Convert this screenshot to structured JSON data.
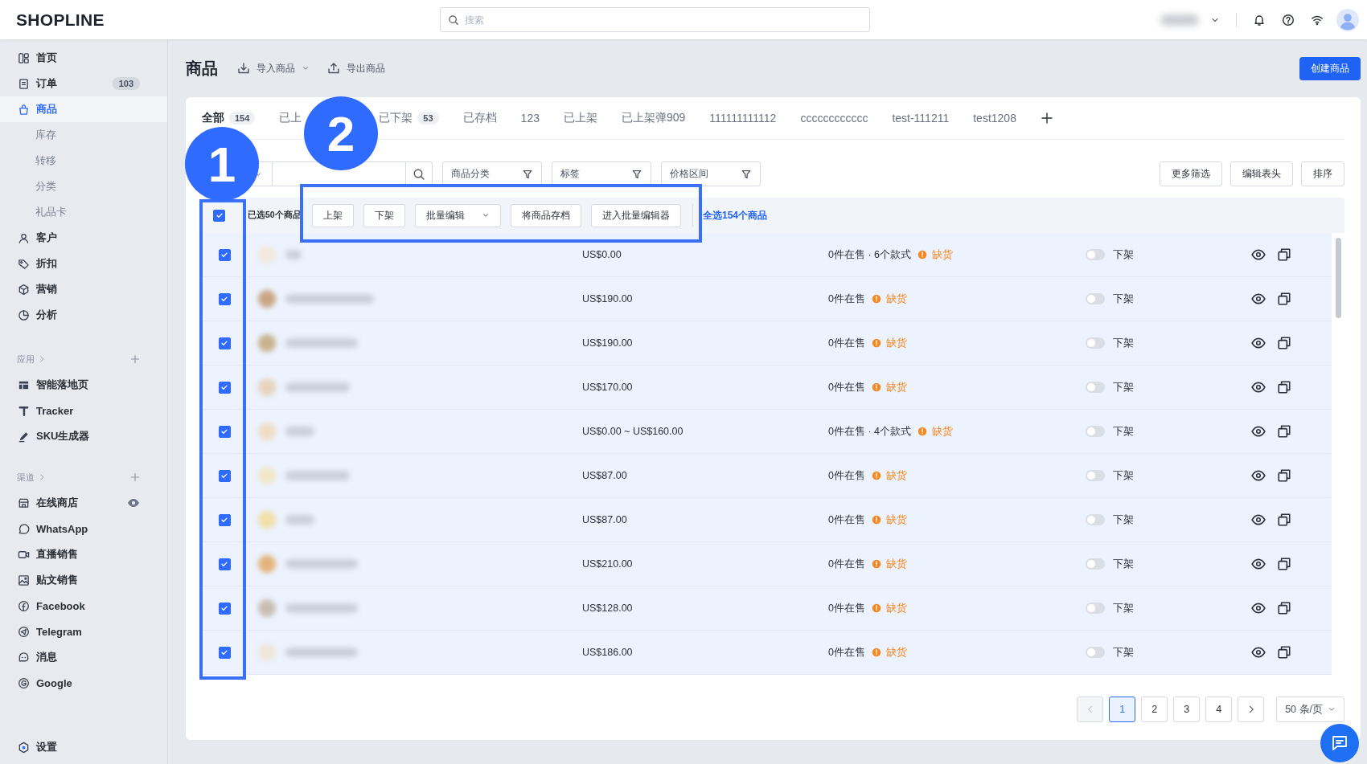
{
  "topbar": {
    "logo": "SHOPLINE",
    "search": {
      "placeholder": "搜索"
    }
  },
  "sidebar": {
    "items": [
      {
        "label": "首页",
        "selected": false
      },
      {
        "label": "订单",
        "badge": "103",
        "selected": false
      },
      {
        "label": "商品",
        "selected": true,
        "children": [
          {
            "label": "库存",
            "selected": false
          },
          {
            "label": "转移",
            "selected": false
          },
          {
            "label": "分类",
            "selected": false
          },
          {
            "label": "礼品卡",
            "selected": false
          }
        ]
      },
      {
        "label": "客户",
        "selected": false
      },
      {
        "label": "折扣",
        "selected": false
      },
      {
        "label": "营销",
        "selected": false
      },
      {
        "label": "分析",
        "selected": false
      }
    ],
    "sections": [
      {
        "title": "应用",
        "items": [
          {
            "label": "智能落地页",
            "selected": false
          },
          {
            "label": "Tracker",
            "selected": false
          },
          {
            "label": "SKU生成器",
            "selected": false
          }
        ]
      },
      {
        "title": "渠道",
        "items": [
          {
            "label": "在线商店",
            "selected": false,
            "preview": true
          },
          {
            "label": "WhatsApp",
            "selected": false
          },
          {
            "label": "直播销售",
            "selected": false
          },
          {
            "label": "贴文销售",
            "selected": false
          },
          {
            "label": "Facebook",
            "selected": false
          },
          {
            "label": "Telegram",
            "selected": false
          },
          {
            "label": "消息",
            "selected": false
          },
          {
            "label": "Google",
            "selected": false
          }
        ]
      }
    ],
    "footer": {
      "label": "设置"
    }
  },
  "header": {
    "title": "商品",
    "actions": [
      {
        "label": "导入商品",
        "dropdown": true
      },
      {
        "label": "导出商品",
        "dropdown": false
      }
    ],
    "primary_button": "创建商品"
  },
  "tabs": [
    {
      "label": "全部",
      "count": "154",
      "selected": true
    },
    {
      "label": "已上",
      "selected": false
    },
    {
      "label": "已下架",
      "count": "53",
      "selected": false
    },
    {
      "label": "已存档",
      "selected": false
    },
    {
      "label": "123",
      "selected": false
    },
    {
      "label": "已上架",
      "selected": false
    },
    {
      "label": "已上架弹909",
      "selected": false
    },
    {
      "label": "111111111112",
      "selected": false
    },
    {
      "label": "cccccccccccc",
      "selected": false
    },
    {
      "label": "test-111211",
      "selected": false
    },
    {
      "label": "test1208",
      "selected": false
    }
  ],
  "filters": [
    {
      "label": "商品分类"
    },
    {
      "label": "标签"
    },
    {
      "label": "价格区间"
    }
  ],
  "toolbar_buttons": [
    "更多筛选",
    "编辑表头",
    "排序"
  ],
  "bulk_bar": {
    "checked": true,
    "selection": "已选50个商品",
    "actions": [
      {
        "label": "上架",
        "dropdown": false
      },
      {
        "label": "下架",
        "dropdown": false
      },
      {
        "label": "批量编辑",
        "dropdown": true
      },
      {
        "label": "将商品存档",
        "dropdown": false
      },
      {
        "label": "进入批量编辑器",
        "dropdown": false
      }
    ],
    "select_all": "全选154个商品"
  },
  "rows": [
    {
      "checked": true,
      "price": "US$0.00",
      "stock": "0件在售 · 6个款式",
      "status": "缺货",
      "listed": false,
      "listing": "下架"
    },
    {
      "checked": true,
      "price": "US$190.00",
      "stock": "0件在售",
      "status": "缺货",
      "listed": false,
      "listing": "下架"
    },
    {
      "checked": true,
      "price": "US$190.00",
      "stock": "0件在售",
      "status": "缺货",
      "listed": false,
      "listing": "下架"
    },
    {
      "checked": true,
      "price": "US$170.00",
      "stock": "0件在售",
      "status": "缺货",
      "listed": false,
      "listing": "下架"
    },
    {
      "checked": true,
      "price": "US$0.00 ~ US$160.00",
      "stock": "0件在售 · 4个款式",
      "status": "缺货",
      "listed": false,
      "listing": "下架"
    },
    {
      "checked": true,
      "price": "US$87.00",
      "stock": "0件在售",
      "status": "缺货",
      "listed": false,
      "listing": "下架"
    },
    {
      "checked": true,
      "price": "US$87.00",
      "stock": "0件在售",
      "status": "缺货",
      "listed": false,
      "listing": "下架"
    },
    {
      "checked": true,
      "price": "US$210.00",
      "stock": "0件在售",
      "status": "缺货",
      "listed": false,
      "listing": "下架"
    },
    {
      "checked": true,
      "price": "US$128.00",
      "stock": "0件在售",
      "status": "缺货",
      "listed": false,
      "listing": "下架"
    },
    {
      "checked": true,
      "price": "US$186.00",
      "stock": "0件在售",
      "status": "缺货",
      "listed": false,
      "listing": "下架"
    }
  ],
  "pagination": {
    "prev_disabled": true,
    "pages": [
      {
        "label": "1",
        "selected": true
      },
      {
        "label": "2",
        "selected": false
      },
      {
        "label": "3",
        "selected": false
      },
      {
        "label": "4",
        "selected": false
      }
    ],
    "page_size": "50 条/页"
  },
  "annotations": [
    {
      "label": "1"
    },
    {
      "label": "2"
    }
  ]
}
